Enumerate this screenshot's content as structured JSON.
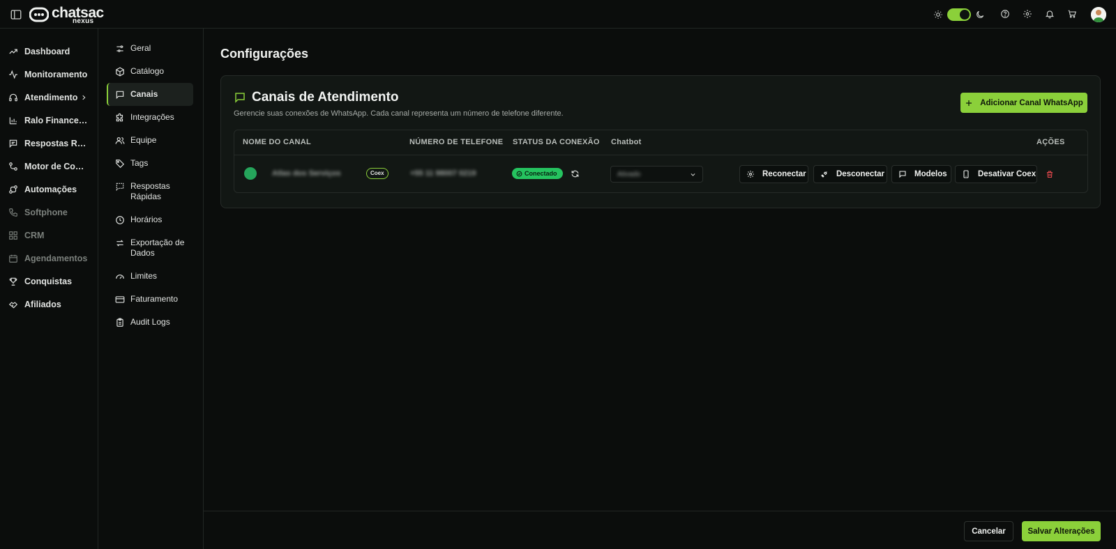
{
  "brand": {
    "name": "chatsac",
    "sub": "nexus",
    "accent": "#8bd03a"
  },
  "topbar": {
    "icons": [
      "sidebar-toggle-icon",
      "sun-icon",
      "moon-icon",
      "help-icon",
      "settings-icon",
      "bell-icon",
      "cart-icon"
    ],
    "theme_dark_on": true
  },
  "sidebar": {
    "items": [
      {
        "label": "Dashboard",
        "icon": "trending-icon"
      },
      {
        "label": "Monitoramento",
        "icon": "activity-icon"
      },
      {
        "label": "Atendimento",
        "icon": "headset-icon"
      },
      {
        "label": "Ralo Financeiro",
        "icon": "bar-chart-icon"
      },
      {
        "label": "Respostas Rápidas",
        "icon": "message-icon"
      },
      {
        "label": "Motor de Conversão",
        "icon": "workflow-icon"
      },
      {
        "label": "Automações",
        "icon": "automation-icon"
      },
      {
        "label": "Softphone",
        "icon": "phone-icon"
      },
      {
        "label": "CRM",
        "icon": "grid-icon"
      },
      {
        "label": "Agendamentos",
        "icon": "calendar-icon"
      },
      {
        "label": "Conquistas",
        "icon": "trophy-icon"
      },
      {
        "label": "Afiliados",
        "icon": "handshake-icon"
      }
    ]
  },
  "subnav": {
    "items": [
      {
        "label": "Geral"
      },
      {
        "label": "Catálogo"
      },
      {
        "label": "Canais"
      },
      {
        "label": "Integrações"
      },
      {
        "label": "Equipe"
      },
      {
        "label": "Tags"
      },
      {
        "label": "Respostas Rápidas"
      },
      {
        "label": "Horários"
      },
      {
        "label": "Exportação de Dados"
      },
      {
        "label": "Limites"
      },
      {
        "label": "Faturamento"
      },
      {
        "label": "Audit Logs"
      }
    ],
    "active": "Canais"
  },
  "main": {
    "title": "Configurações",
    "card": {
      "title": "Canais de Atendimento",
      "subtitle": "Gerencie suas conexões de WhatsApp. Cada canal representa um número de telefone diferente.",
      "add_button": "Adicionar Canal WhatsApp",
      "table": {
        "headers": [
          "NOME DO CANAL",
          "NÚMERO DE TELEFONE",
          "STATUS DA CONEXÃO",
          "Chatbot",
          "AÇÕES"
        ],
        "row": {
          "channel_name": "Atlas dos Serviços",
          "badge": "Coex",
          "phone": "+55 11 98007 0219",
          "status": "Conectado",
          "chatbot": "Ativado"
        },
        "actions": [
          "Reconectar",
          "Desconectar",
          "Modelos",
          "Desativar Coex"
        ]
      }
    }
  },
  "footer": {
    "cancel": "Cancelar",
    "save": "Salvar Alterações"
  }
}
